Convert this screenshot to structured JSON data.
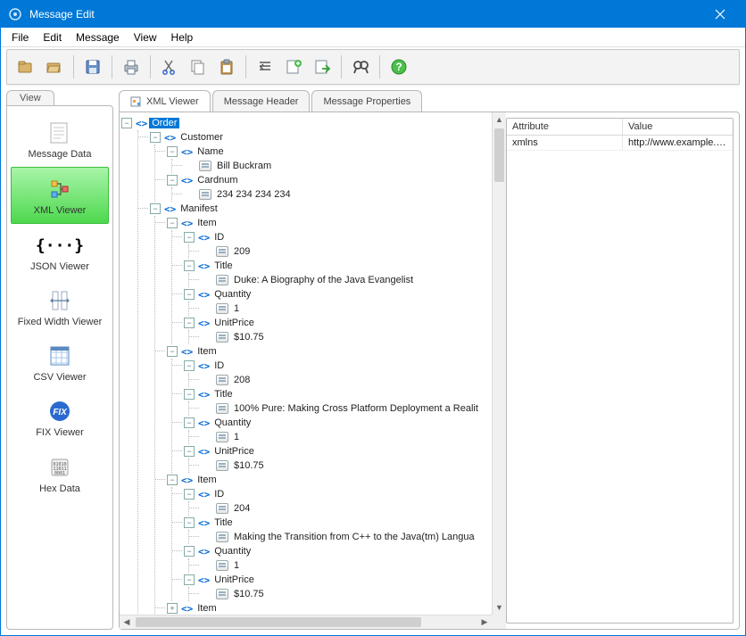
{
  "window": {
    "title": "Message Edit"
  },
  "menubar": [
    "File",
    "Edit",
    "Message",
    "View",
    "Help"
  ],
  "sidebar": {
    "tab_label": "View",
    "items": [
      {
        "label": "Message Data",
        "name": "message-data"
      },
      {
        "label": "XML Viewer",
        "name": "xml-viewer",
        "selected": true
      },
      {
        "label": "JSON Viewer",
        "name": "json-viewer"
      },
      {
        "label": "Fixed Width Viewer",
        "name": "fixed-width-viewer"
      },
      {
        "label": "CSV Viewer",
        "name": "csv-viewer"
      },
      {
        "label": "FIX Viewer",
        "name": "fix-viewer"
      },
      {
        "label": "Hex Data",
        "name": "hex-data"
      }
    ]
  },
  "tabs": [
    {
      "label": "XML Viewer",
      "active": true
    },
    {
      "label": "Message Header"
    },
    {
      "label": "Message Properties"
    }
  ],
  "attributes": {
    "headers": {
      "attr": "Attribute",
      "val": "Value"
    },
    "rows": [
      {
        "attr": "xmlns",
        "val": "http://www.example.com..."
      }
    ]
  },
  "tree": {
    "name": "Order",
    "selected": true,
    "children": [
      {
        "name": "Customer",
        "children": [
          {
            "name": "Name",
            "children": [
              {
                "value": "Bill Buckram"
              }
            ]
          },
          {
            "name": "Cardnum",
            "children": [
              {
                "value": "234 234 234 234"
              }
            ]
          }
        ]
      },
      {
        "name": "Manifest",
        "children": [
          {
            "name": "Item",
            "children": [
              {
                "name": "ID",
                "children": [
                  {
                    "value": "209"
                  }
                ]
              },
              {
                "name": "Title",
                "children": [
                  {
                    "value": "Duke: A Biography of the Java Evangelist"
                  }
                ]
              },
              {
                "name": "Quantity",
                "children": [
                  {
                    "value": "1"
                  }
                ]
              },
              {
                "name": "UnitPrice",
                "children": [
                  {
                    "value": "$10.75"
                  }
                ]
              }
            ]
          },
          {
            "name": "Item",
            "children": [
              {
                "name": "ID",
                "children": [
                  {
                    "value": "208"
                  }
                ]
              },
              {
                "name": "Title",
                "children": [
                  {
                    "value": "100% Pure: Making Cross Platform Deployment a Realit"
                  }
                ]
              },
              {
                "name": "Quantity",
                "children": [
                  {
                    "value": "1"
                  }
                ]
              },
              {
                "name": "UnitPrice",
                "children": [
                  {
                    "value": "$10.75"
                  }
                ]
              }
            ]
          },
          {
            "name": "Item",
            "children": [
              {
                "name": "ID",
                "children": [
                  {
                    "value": "204"
                  }
                ]
              },
              {
                "name": "Title",
                "children": [
                  {
                    "value": "Making the Transition from C++ to the Java(tm) Langua"
                  }
                ]
              },
              {
                "name": "Quantity",
                "children": [
                  {
                    "value": "1"
                  }
                ]
              },
              {
                "name": "UnitPrice",
                "children": [
                  {
                    "value": "$10.75"
                  }
                ]
              }
            ]
          },
          {
            "name": "Item",
            "collapsed": true
          }
        ]
      }
    ]
  }
}
